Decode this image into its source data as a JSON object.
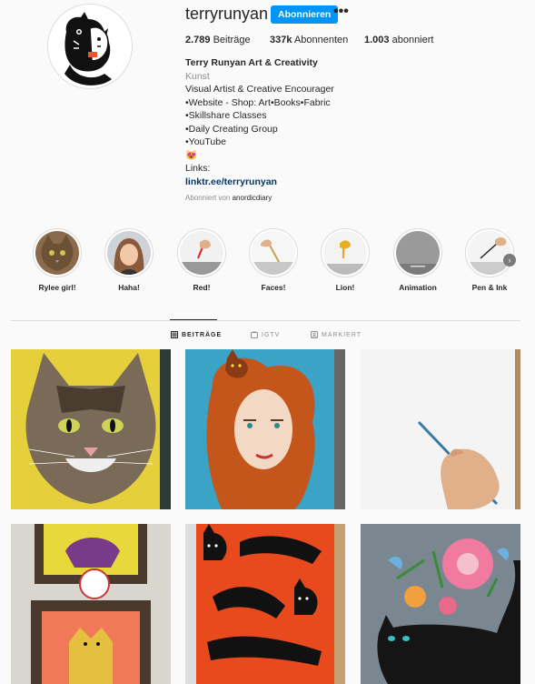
{
  "profile": {
    "username": "terryrunyan",
    "follow_label": "Abonnieren",
    "more_label": "•••",
    "stats": {
      "posts_count": "2.789",
      "posts_label": "Beiträge",
      "followers_count": "337k",
      "followers_label": "Abonnenten",
      "following_count": "1.003",
      "following_label": "abonniert"
    },
    "bio": {
      "name": "Terry Runyan Art & Creativity",
      "category": "Kunst",
      "lines": [
        "Visual Artist & Creative Encourager",
        "•Website - Shop: Art•Books•Fabric",
        "•Skillshare Classes",
        "•Daily Creating Group",
        "•YouTube",
        "😻",
        "Links:"
      ],
      "link": "linktr.ee/terryrunyan",
      "followed_by_prefix": "Abonniert von",
      "followed_by_user": "anordicdiary"
    }
  },
  "highlights": [
    {
      "label": "Rylee girl!",
      "icon": "cat-photo"
    },
    {
      "label": "Haha!",
      "icon": "woman-photo"
    },
    {
      "label": "Red!",
      "icon": "painting-hand"
    },
    {
      "label": "Faces!",
      "icon": "painting-hand"
    },
    {
      "label": "Lion!",
      "icon": "painting-hand"
    },
    {
      "label": "Animation",
      "icon": "grey-canvas"
    },
    {
      "label": "Pen & Ink",
      "icon": "painting-hand"
    }
  ],
  "tabs": [
    {
      "label": "BEITRÄGE",
      "icon": "grid-icon",
      "active": true
    },
    {
      "label": "IGTV",
      "icon": "tv-icon",
      "active": false
    },
    {
      "label": "MARKIERT",
      "icon": "tag-icon",
      "active": false
    }
  ],
  "posts": [
    {
      "subject": "tabby-cat-painting"
    },
    {
      "subject": "red-hair-woman-with-cat"
    },
    {
      "subject": "hand-painting-on-paper"
    },
    {
      "subject": "framed-cat-stitching"
    },
    {
      "subject": "black-cats-on-orange"
    },
    {
      "subject": "black-cat-with-flowers"
    }
  ],
  "colors": {
    "accent": "#0095f6",
    "link": "#00376b",
    "text": "#262626",
    "muted": "#8e8e8e",
    "background": "#fafafa"
  }
}
